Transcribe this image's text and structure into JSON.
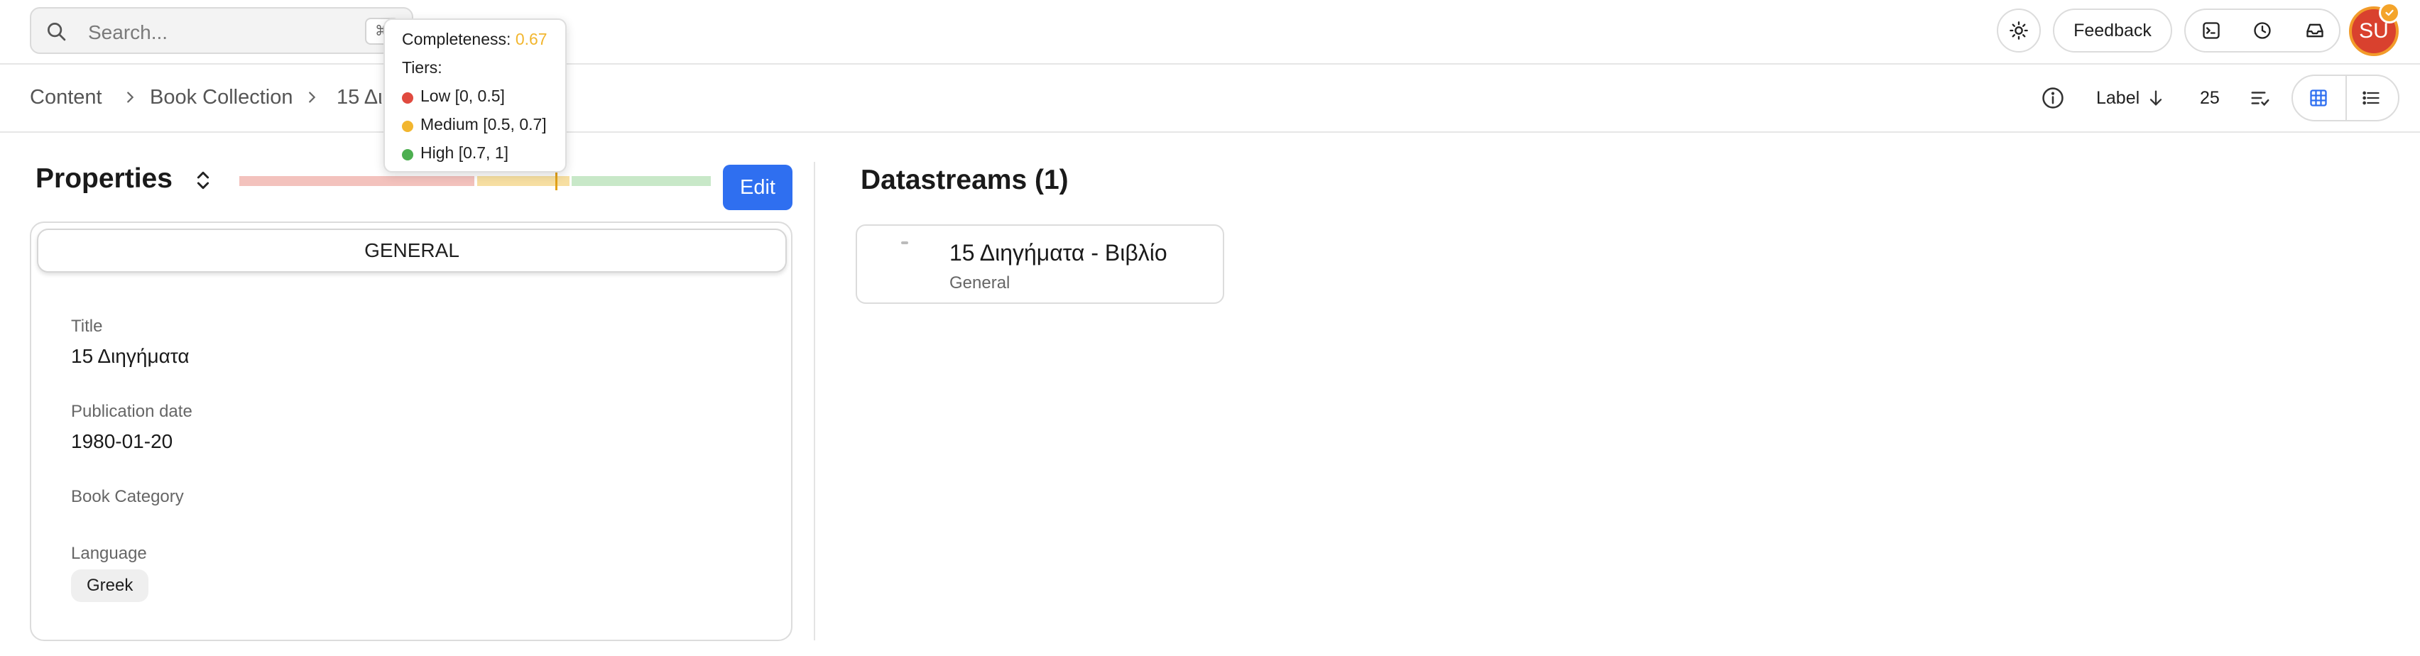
{
  "header": {
    "search_placeholder": "Search...",
    "search_shortcut": "⌘",
    "feedback_label": "Feedback",
    "avatar_initials": "SU"
  },
  "breadcrumb": [
    "Content",
    "Book Collection",
    "15 Δι"
  ],
  "toolbar": {
    "sort_label": "Label",
    "page_size": "25"
  },
  "properties": {
    "title": "Properties",
    "edit_label": "Edit",
    "tab_label": "GENERAL",
    "completeness": 0.67,
    "fields": [
      {
        "label": "Title",
        "value": "15 Διηγήματα"
      },
      {
        "label": "Publication date",
        "value": "1980-01-20"
      },
      {
        "label": "Book Category",
        "value": ""
      },
      {
        "label": "Language",
        "value": "Greek"
      }
    ]
  },
  "datastreams": {
    "title": "Datastreams (1)",
    "items": [
      {
        "name": "15 Διηγήματα - Βιβλίο",
        "subtitle": "General"
      }
    ]
  },
  "tooltip": {
    "completeness_label": "Completeness:",
    "completeness_value": "0.67",
    "tiers_label": "Tiers:",
    "tiers": [
      {
        "label": "Low [0, 0.5]",
        "color": "#e04a3f"
      },
      {
        "label": "Medium [0.5, 0.7]",
        "color": "#f2b62f"
      },
      {
        "label": "High [0.7, 1]",
        "color": "#4caf50"
      }
    ]
  },
  "colors": {
    "accent": "#2f6ff0",
    "completeness_value": "#f2b62f",
    "tier_low_bar": "#f3c2bd",
    "tier_medium_bar": "#f7dfa2",
    "tier_high_bar": "#c8e8c8",
    "avatar": "#d9412e"
  }
}
